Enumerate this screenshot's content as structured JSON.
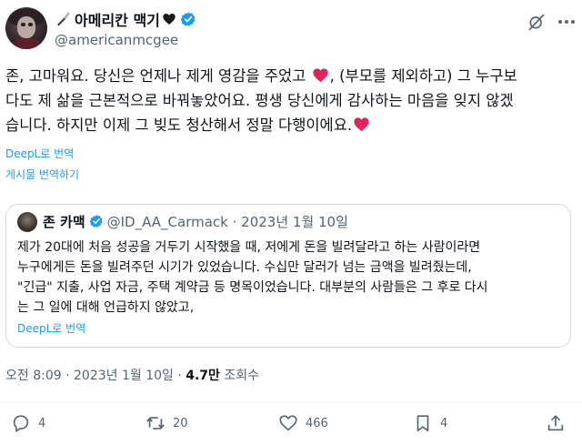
{
  "author": {
    "display_name": "아메리칸 맥기",
    "handle": "@americanmcgee",
    "icons": [
      "knife-icon",
      "black-heart-icon",
      "verified-badge-icon"
    ]
  },
  "header_icons": [
    "grok-icon",
    "more-options-icon"
  ],
  "tweet": {
    "lines": [
      {
        "before": "존, 고마워요. 당신은 언제나 제게 영감을 주었고 ",
        "heart": true,
        "after": ", (부모를 제외하고) 그 누구보"
      },
      {
        "before": "다도 제 삶을 근본적으로 바꿔놓았어요. 평생 당신에게 감사하는 마음을 잊지 않겠",
        "heart": false,
        "after": ""
      },
      {
        "before": "습니다. 하지만 이제 그 빚도 청산해서 정말 다행이에요.",
        "heart": true,
        "after": ""
      }
    ],
    "deepl_link": "DeepL로 번역",
    "translate_post": "게시물 번역하기"
  },
  "quoted_tweet": {
    "name": "존 카맥",
    "handle_date": "@ID_AA_Carmack · 2023년 1월 10일",
    "lines": [
      "제가 20대에 처음 성공을 거두기 시작했을 때, 저에게 돈을 빌려달라고 하는 사람이라면",
      "누구에게든 돈을 빌려주던 시기가 있었습니다. 수십만 달러가 넘는 금액을 빌려줬는데,",
      "\"긴급\" 지출, 사업 자금, 주택 계약금 등 명목이었습니다. 대부분의 사람들은 그 후로 다시",
      "는 그 일에 대해 언급하지 않았고,"
    ],
    "deepl_link": "DeepL로 번역"
  },
  "meta": {
    "time_date": "오전 8:09 · 2023년 1월 10일 · ",
    "views": "4.7만",
    "views_label": " 조회수"
  },
  "actions": {
    "replies": "4",
    "retweets": "20",
    "likes": "466",
    "bookmarks": "4"
  },
  "colors": {
    "accent": "#1d9bf0",
    "heart_red": "#e0245e",
    "muted": "#536471",
    "text": "#0f1419",
    "border": "#cfd9de"
  }
}
